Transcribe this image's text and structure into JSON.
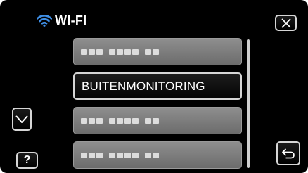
{
  "header": {
    "title": "WI-FI",
    "wifi_icon": "wifi-icon",
    "accent_color": "#3f8fe6"
  },
  "controls": {
    "close_icon": "close-icon",
    "down_icon": "chevron-down-icon",
    "help_label": "?",
    "back_icon": "back-return-icon"
  },
  "network_list": {
    "items": [
      {
        "label": "",
        "masked": true,
        "selected": false
      },
      {
        "label": "BUITENMONITORING",
        "masked": false,
        "selected": true
      },
      {
        "label": "",
        "masked": true,
        "selected": false
      },
      {
        "label": "",
        "masked": true,
        "selected": false
      }
    ]
  }
}
